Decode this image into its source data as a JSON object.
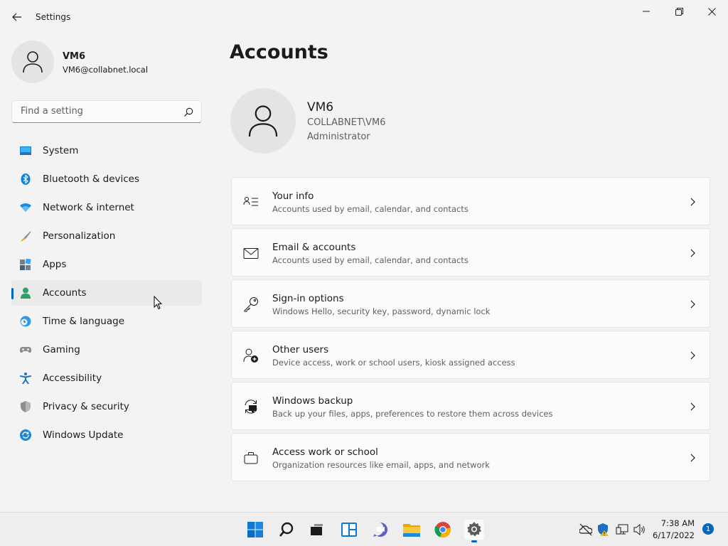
{
  "window": {
    "title": "Settings",
    "controls": [
      "minimize",
      "maximize",
      "close"
    ]
  },
  "user": {
    "name": "VM6",
    "email": "VM6@collabnet.local"
  },
  "search": {
    "placeholder": "Find a setting",
    "value": ""
  },
  "nav": {
    "items": [
      {
        "label": "System",
        "icon": "system-icon"
      },
      {
        "label": "Bluetooth & devices",
        "icon": "bluetooth-icon"
      },
      {
        "label": "Network & internet",
        "icon": "wifi-icon"
      },
      {
        "label": "Personalization",
        "icon": "brush-icon"
      },
      {
        "label": "Apps",
        "icon": "apps-icon"
      },
      {
        "label": "Accounts",
        "icon": "person-icon",
        "active": true
      },
      {
        "label": "Time & language",
        "icon": "clock-globe-icon"
      },
      {
        "label": "Gaming",
        "icon": "gamepad-icon"
      },
      {
        "label": "Accessibility",
        "icon": "accessibility-icon"
      },
      {
        "label": "Privacy & security",
        "icon": "shield-icon"
      },
      {
        "label": "Windows Update",
        "icon": "update-icon"
      }
    ]
  },
  "main": {
    "title": "Accounts",
    "profile": {
      "name": "VM6",
      "domain": "COLLABNET\\VM6",
      "role": "Administrator"
    },
    "cards": [
      {
        "title": "Your info",
        "subtitle": "Accounts used by email, calendar, and contacts",
        "icon": "info-list-icon"
      },
      {
        "title": "Email & accounts",
        "subtitle": "Accounts used by email, calendar, and contacts",
        "icon": "mail-icon"
      },
      {
        "title": "Sign-in options",
        "subtitle": "Windows Hello, security key, password, dynamic lock",
        "icon": "key-icon"
      },
      {
        "title": "Other users",
        "subtitle": "Device access, work or school users, kiosk assigned access",
        "icon": "add-person-icon"
      },
      {
        "title": "Windows backup",
        "subtitle": "Back up your files, apps, preferences to restore them across devices",
        "icon": "backup-icon"
      },
      {
        "title": "Access work or school",
        "subtitle": "Organization resources like email, apps, and network",
        "icon": "briefcase-icon"
      }
    ]
  },
  "taskbar": {
    "apps": [
      "start-icon",
      "search-icon",
      "task-view-icon",
      "widgets-icon",
      "chat-icon",
      "file-explorer-icon",
      "chrome-icon",
      "settings-icon"
    ],
    "active_app": "settings-icon",
    "tray": [
      "onedrive-icon",
      "security-icon",
      "network-icon",
      "volume-icon"
    ],
    "time": "7:38 AM",
    "date": "6/17/2022",
    "notification_count": "1"
  },
  "colors": {
    "accent": "#0067c0",
    "background": "#f3f3f3",
    "card": "#fbfbfb"
  }
}
